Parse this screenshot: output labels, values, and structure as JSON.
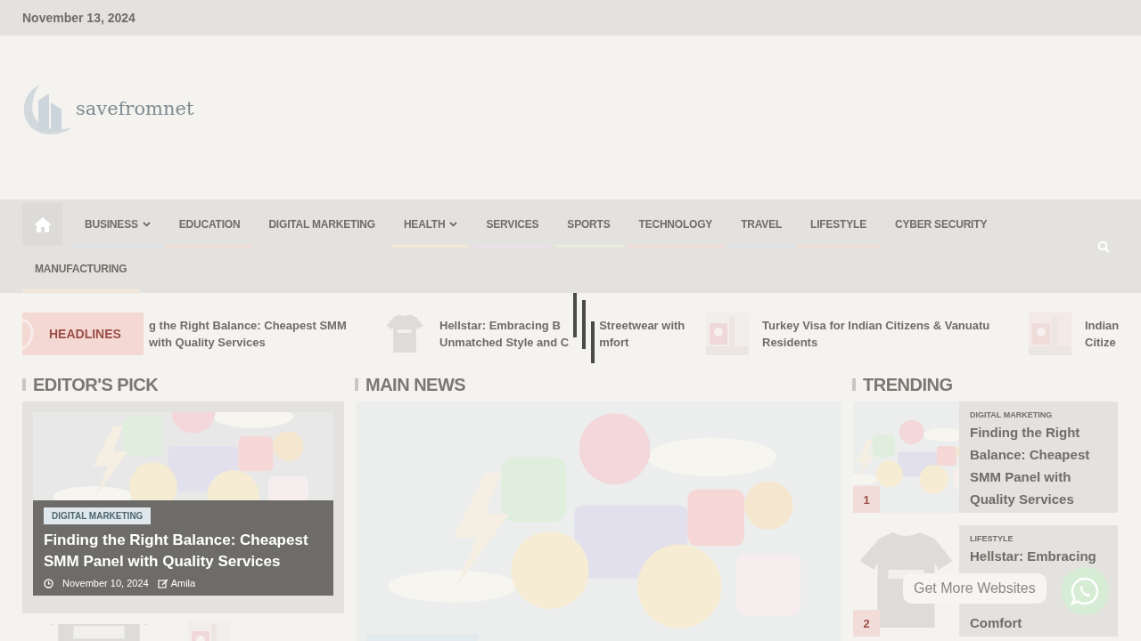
{
  "top_bar": {
    "date": "November 13, 2024"
  },
  "logo": {
    "text": "savefromnet"
  },
  "nav": {
    "items": [
      {
        "label": "BUSINESS",
        "dropdown": true,
        "color": "#dce3e9"
      },
      {
        "label": "EDUCATION",
        "dropdown": false,
        "color": "#f1dcd8"
      },
      {
        "label": "DIGITAL MARKETING",
        "dropdown": false,
        "color": "#e5e3df"
      },
      {
        "label": "HEALTH",
        "dropdown": true,
        "color": "#f3e6d4"
      },
      {
        "label": "SERVICES",
        "dropdown": false,
        "color": "#ecdfe9"
      },
      {
        "label": "SPORTS",
        "dropdown": false,
        "color": "#e9ecda"
      },
      {
        "label": "TECHNOLOGY",
        "dropdown": false,
        "color": "#f1dcd8"
      },
      {
        "label": "TRAVEL",
        "dropdown": false,
        "color": "#dce4ea"
      },
      {
        "label": "LIFESTYLE",
        "dropdown": false,
        "color": "#f1dcd8"
      },
      {
        "label": "CYBER SECURITY",
        "dropdown": false,
        "color": "#e5e3df"
      },
      {
        "label": "MANUFACTURING",
        "dropdown": false,
        "color": "#f5e7d9"
      }
    ]
  },
  "headlines": {
    "label": "HEADLINES",
    "items": [
      {
        "kind": "none",
        "lines": [
          [
            "g the Right Balance: Cheapest SMM"
          ],
          [
            "with Quality Services"
          ]
        ]
      },
      {
        "kind": "tshirt",
        "lines": [
          [
            "Hellstar: Embracing B",
            "Streetwear with"
          ],
          [
            "Unmatched Style and C",
            "mfort"
          ]
        ]
      },
      {
        "lines": [
          [
            "Turkey Visa for Indian Citizens & Vanuatu"
          ],
          [
            "Residents"
          ]
        ]
      },
      {
        "lines": [
          [
            "Indian"
          ],
          [
            "Citize"
          ]
        ]
      }
    ]
  },
  "editors_pick": {
    "heading": "EDITOR'S PICK",
    "category": "DIGITAL MARKETING",
    "title": "Finding the Right Balance: Cheapest SMM Panel with Quality Services",
    "date": "November 10, 2024",
    "author": "Amila"
  },
  "main_news": {
    "heading": "MAIN NEWS"
  },
  "trending": {
    "heading": "TRENDING",
    "items": [
      {
        "rank": "1",
        "kind": "collage",
        "category": "DIGITAL MARKETING",
        "lines": [
          "Finding the Right",
          "Balance: Cheapest",
          "SMM Panel with",
          "Quality Services"
        ]
      },
      {
        "rank": "2",
        "kind": "tshirt",
        "category": "LIFESTYLE",
        "lines": [
          "Hellstar: Embracing",
          "Comfort"
        ]
      }
    ]
  },
  "chat_widget": {
    "label": "Get More Websites"
  }
}
